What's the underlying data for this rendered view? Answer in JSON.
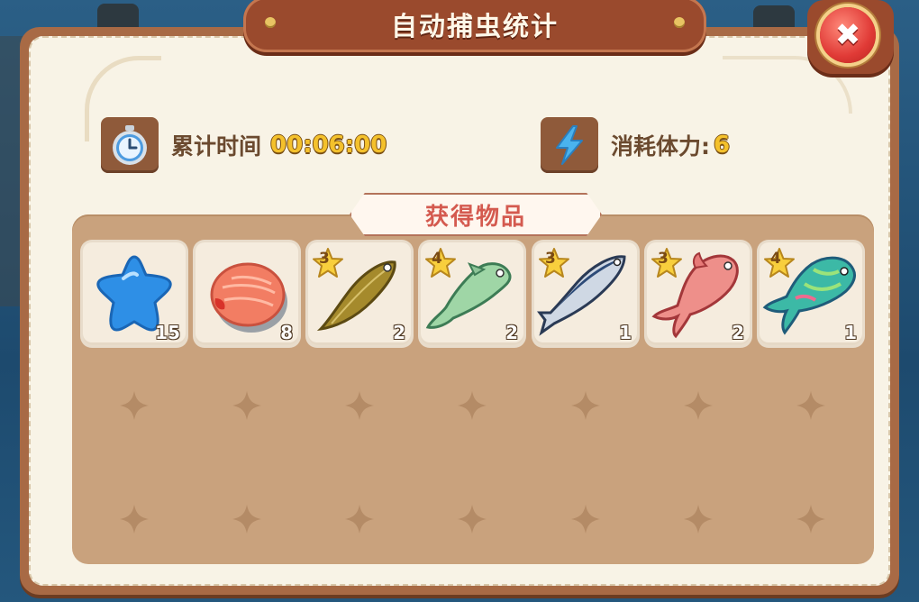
{
  "header": {
    "title": "自动捕虫统计"
  },
  "stats": {
    "time_label": "累计时间",
    "time_value": "00:06:00",
    "stamina_label": "消耗体力:",
    "stamina_value": "6"
  },
  "section": {
    "title": "获得物品"
  },
  "items": [
    {
      "name": "blue-star",
      "count": "15",
      "stars": ""
    },
    {
      "name": "salmon-steak",
      "count": "8",
      "stars": ""
    },
    {
      "name": "flatfish",
      "count": "2",
      "stars": "3"
    },
    {
      "name": "green-fish",
      "count": "2",
      "stars": "4"
    },
    {
      "name": "mackerel",
      "count": "1",
      "stars": "3"
    },
    {
      "name": "red-snapper",
      "count": "2",
      "stars": "3"
    },
    {
      "name": "parrotfish",
      "count": "1",
      "stars": "4"
    }
  ],
  "colors": {
    "accent": "#9a4a2d",
    "value_gold": "#f4c12c",
    "section_text": "#d45a4f"
  }
}
